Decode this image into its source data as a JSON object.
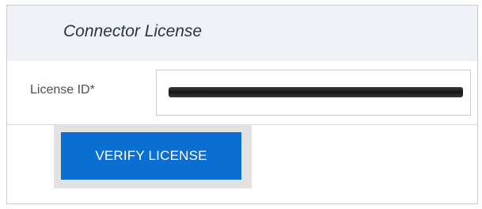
{
  "panel": {
    "title": "Connector License"
  },
  "license_field": {
    "label": "License ID*",
    "value": ""
  },
  "actions": {
    "verify_label": "VERIFY LICENSE"
  }
}
